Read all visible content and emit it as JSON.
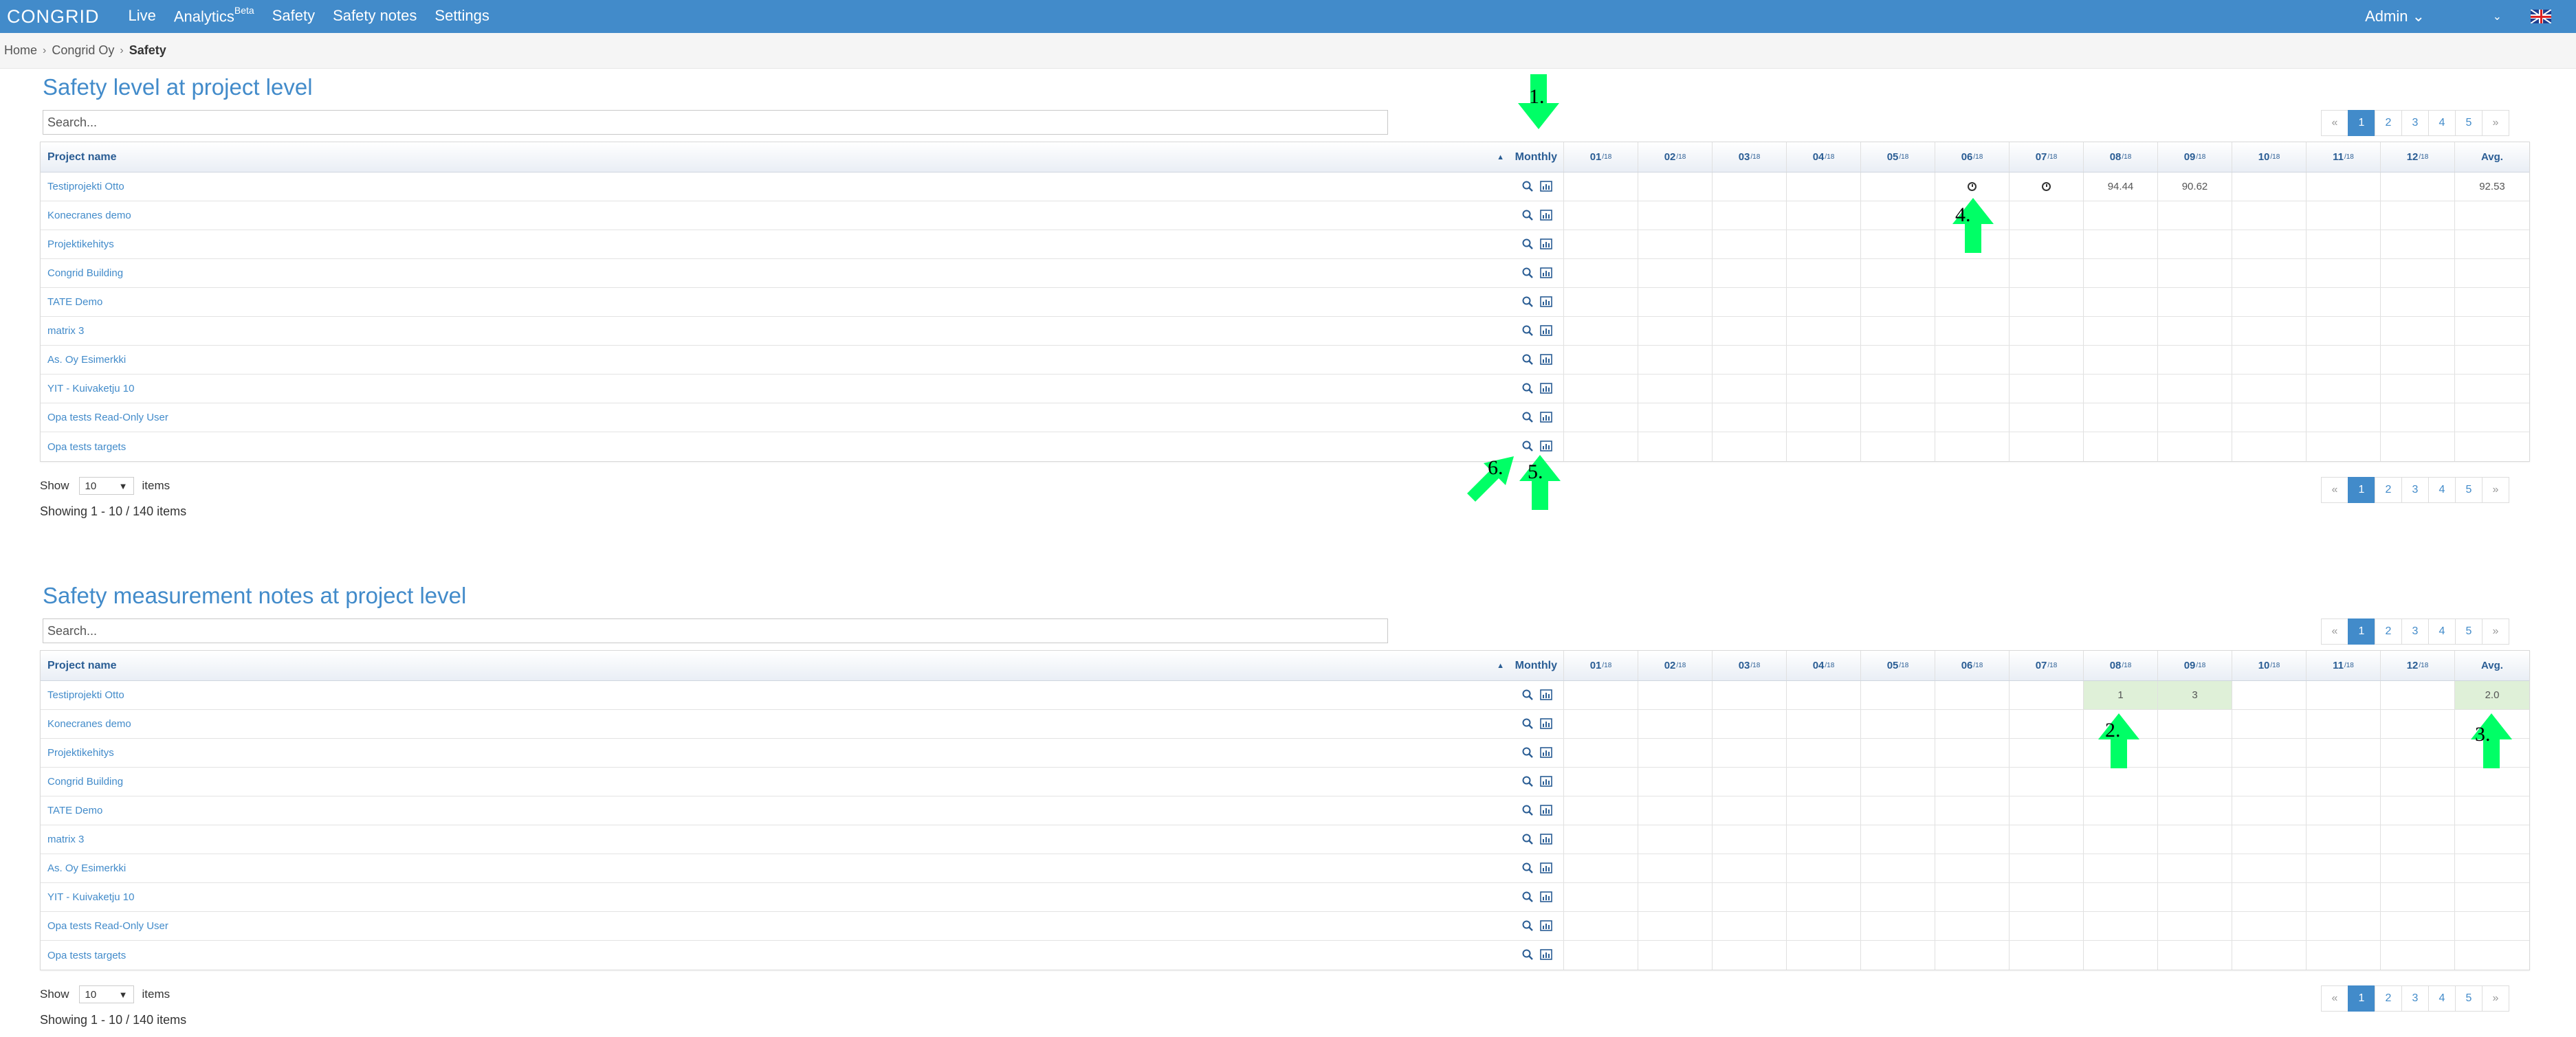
{
  "nav": {
    "logo": "CONGRID",
    "links": [
      "Live",
      "Analytics",
      "Safety",
      "Safety notes",
      "Settings"
    ],
    "analytics_badge": "Beta",
    "admin": "Admin",
    "admin_caret": "⌄",
    "dropdown_caret": "⌄",
    "flag_icon": "uk-flag-icon"
  },
  "breadcrumb": {
    "items": [
      "Home",
      "Congrid Oy",
      "Safety"
    ],
    "separator": "›"
  },
  "headers": {
    "project_name": "Project name",
    "monthly": "Monthly",
    "sort": "▲",
    "months": [
      {
        "m": "01",
        "y": "/18"
      },
      {
        "m": "02",
        "y": "/18"
      },
      {
        "m": "03",
        "y": "/18"
      },
      {
        "m": "04",
        "y": "/18"
      },
      {
        "m": "05",
        "y": "/18"
      },
      {
        "m": "06",
        "y": "/18"
      },
      {
        "m": "07",
        "y": "/18"
      },
      {
        "m": "08",
        "y": "/18"
      },
      {
        "m": "09",
        "y": "/18"
      },
      {
        "m": "10",
        "y": "/18"
      },
      {
        "m": "11",
        "y": "/18"
      },
      {
        "m": "12",
        "y": "/18"
      }
    ],
    "avg": "Avg."
  },
  "projects": [
    "Testiprojekti Otto",
    "Konecranes demo",
    "Projektikehitys",
    "Congrid Building",
    "TATE Demo",
    "matrix 3",
    "As. Oy Esimerkki",
    "YIT - Kuivaketju 10",
    "Opa tests Read-Only User",
    "Opa tests targets"
  ],
  "pagination": {
    "prev": "«",
    "pages": [
      "1",
      "2",
      "3",
      "4",
      "5"
    ],
    "next": "»",
    "active": "1"
  },
  "footer": {
    "show": "Show",
    "per_page": "10",
    "items": "items",
    "showing": "Showing 1 - 10 / 140 items"
  },
  "search_placeholder": "Search...",
  "safety_level": {
    "title": "Safety level at project level",
    "first_row": [
      "",
      "",
      "",
      "",
      "",
      "clock",
      "clock",
      "94.44",
      "90.62",
      "",
      "",
      ""
    ],
    "first_row_avg": "92.53"
  },
  "safety_notes": {
    "title": "Safety measurement notes at project level",
    "first_row": [
      "",
      "",
      "",
      "",
      "",
      "",
      "",
      "1",
      "3",
      "",
      "",
      ""
    ],
    "first_row_avg": "2.0"
  },
  "annotations": [
    "1.",
    "2.",
    "3.",
    "4.",
    "5.",
    "6."
  ],
  "colors": {
    "nav": "#428bca",
    "arrow": "#00ff66",
    "highlight": "#dff0d8",
    "link": "#428bca"
  }
}
